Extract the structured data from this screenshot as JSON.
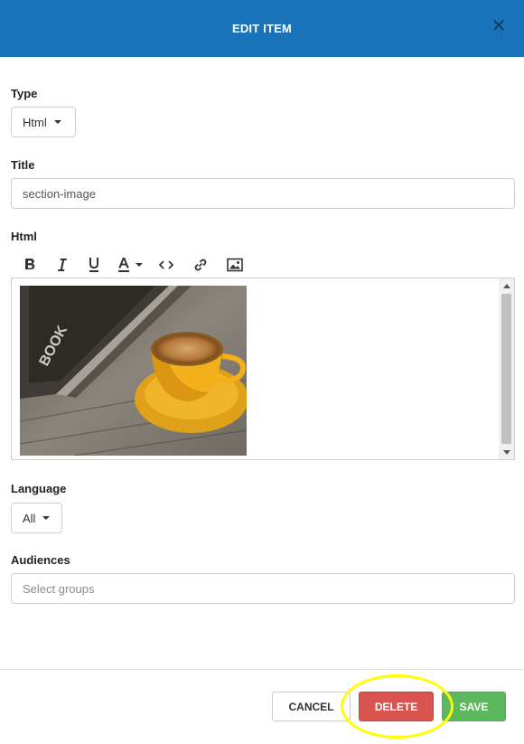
{
  "dialog": {
    "title": "EDIT ITEM",
    "close_symbol": "✕"
  },
  "form": {
    "type": {
      "label": "Type",
      "selected": "Html"
    },
    "title": {
      "label": "Title",
      "value": "section-image"
    },
    "html": {
      "label": "Html",
      "toolbar": [
        "bold-icon",
        "italic-icon",
        "underline-icon",
        "font-color-icon",
        "code-icon",
        "link-icon",
        "image-icon"
      ],
      "content_image": "coffee-cup-on-book-photo"
    },
    "language": {
      "label": "Language",
      "selected": "All"
    },
    "audiences": {
      "label": "Audiences",
      "placeholder": "Select groups"
    }
  },
  "footer": {
    "cancel_label": "CANCEL",
    "delete_label": "DELETE",
    "save_label": "SAVE"
  },
  "colors": {
    "header": "#1a73b8",
    "delete": "#d9534f",
    "save": "#5cb85c",
    "highlight": "#ffff00"
  }
}
